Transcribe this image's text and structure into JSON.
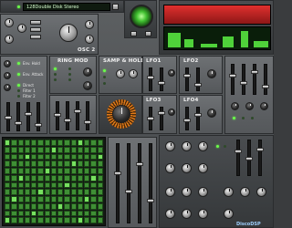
{
  "header": {
    "preset_name": "128Double Disk Stereo",
    "osc2_label": "OSC 2"
  },
  "modules": {
    "ring_mod": "RING MOD",
    "sample_hold": "SAMP & HOLD",
    "lfo1": "LFO1",
    "lfo2": "LFO2",
    "lfo3": "LFO3",
    "lfo4": "LFO4"
  },
  "filter_labels": [
    "Env. Hold",
    "Env. Attack",
    "Direct",
    "Filter 1",
    "Filter 2"
  ],
  "footer": {
    "brand": "DiscoDSP"
  },
  "colors": {
    "accent_green": "#6bff4a",
    "display_red": "#c8201f"
  }
}
